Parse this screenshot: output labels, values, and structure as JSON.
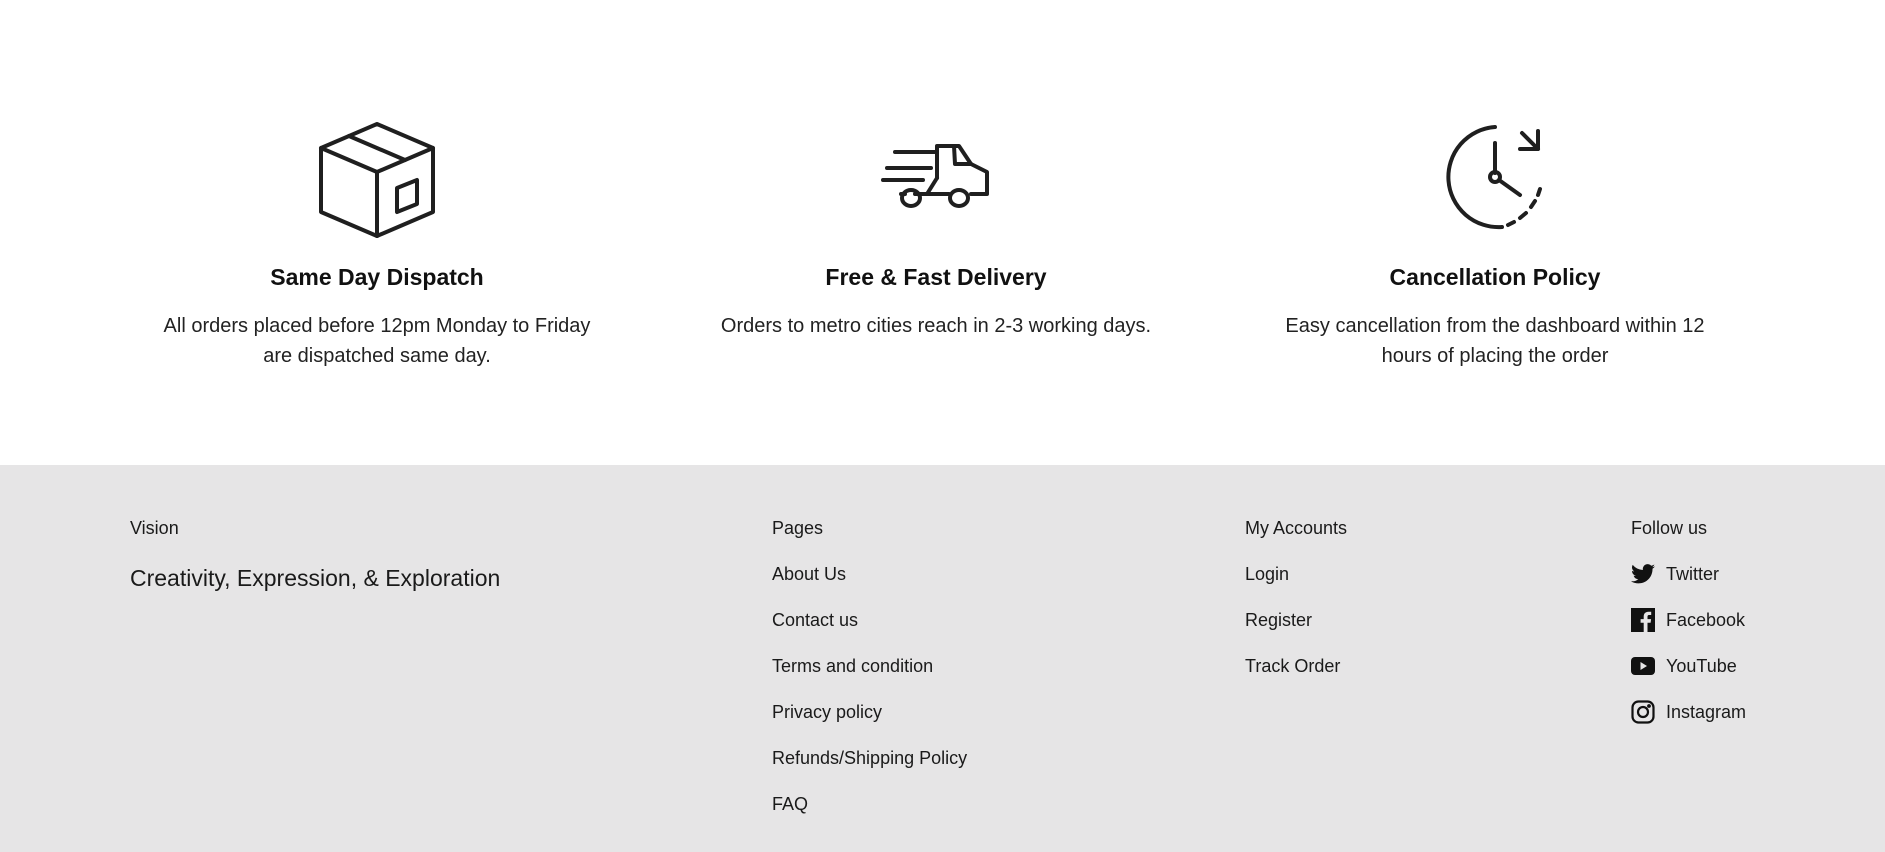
{
  "features": [
    {
      "icon": "package-box-icon",
      "title": "Same Day Dispatch",
      "description": "All orders placed before 12pm Monday to Friday are dispatched same day."
    },
    {
      "icon": "delivery-truck-icon",
      "title": "Free & Fast Delivery",
      "description": "Orders to metro cities reach in 2-3 working days."
    },
    {
      "icon": "clock-refresh-icon",
      "title": "Cancellation Policy",
      "description": "Easy cancellation from the dashboard within 12 hours of placing the order"
    }
  ],
  "footer": {
    "background": "#e6e5e6",
    "vision": {
      "heading": "Vision",
      "text": "Creativity, Expression, & Exploration"
    },
    "pages": {
      "heading": "Pages",
      "links": [
        "About Us",
        "Contact us",
        "Terms and condition",
        "Privacy policy",
        "Refunds/Shipping Policy",
        "FAQ"
      ]
    },
    "accounts": {
      "heading": "My Accounts",
      "links": [
        "Login",
        "Register",
        "Track Order"
      ]
    },
    "social": {
      "heading": "Follow us",
      "links": [
        {
          "label": "Twitter",
          "icon": "twitter-icon"
        },
        {
          "label": "Facebook",
          "icon": "facebook-icon"
        },
        {
          "label": "YouTube",
          "icon": "youtube-icon"
        },
        {
          "label": "Instagram",
          "icon": "instagram-icon"
        }
      ]
    }
  }
}
